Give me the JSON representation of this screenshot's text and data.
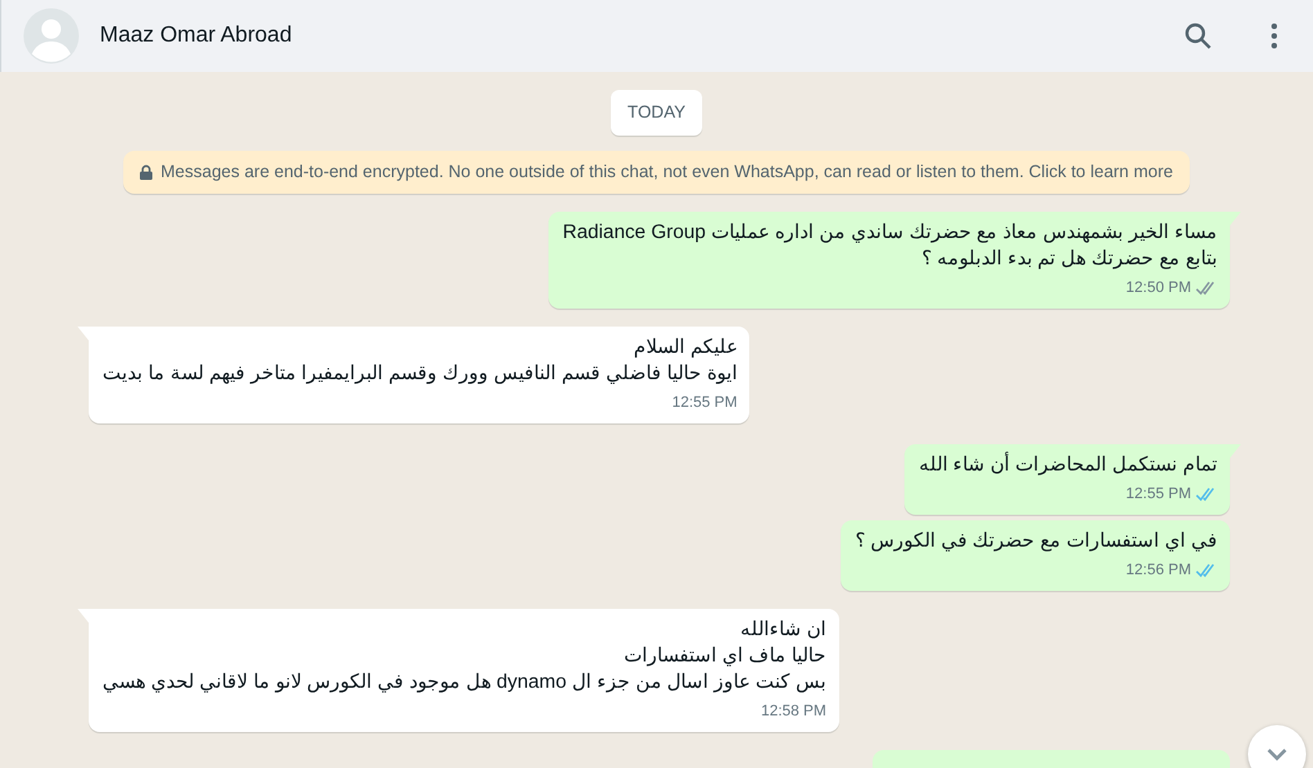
{
  "header": {
    "contact_name": "Maaz Omar Abroad"
  },
  "date_divider": "TODAY",
  "encryption_notice": "Messages are end-to-end encrypted. No one outside of this chat, not even WhatsApp, can read or listen to them. Click to learn more",
  "messages": [
    {
      "kind": "out",
      "lines": [
        "مساء الخير بشمهندس معاذ مع حضرتك ساندي من اداره عمليات Radiance Group",
        "بتابع مع حضرتك هل تم بدء الدبلومه ؟"
      ],
      "time": "12:50 PM",
      "tail": true,
      "read": false
    },
    {
      "kind": "in",
      "lines": [
        "عليكم السلام",
        "ايوة حاليا فاضلي قسم النافيس وورك وقسم البرايمفيرا متاخر فيهم لسة ما بديت"
      ],
      "time": "12:55 PM",
      "tail": true
    },
    {
      "kind": "out",
      "lines": [
        "تمام نستكمل المحاضرات أن شاء الله"
      ],
      "time": "12:55 PM",
      "tail": true,
      "read": true
    },
    {
      "kind": "out",
      "lines": [
        "في اي استفسارات مع حضرتك في الكورس ؟"
      ],
      "time": "12:56 PM",
      "tail": false,
      "read": true
    },
    {
      "kind": "in",
      "lines": [
        "ان شاءالله",
        "حاليا ماف اي استفسارات",
        "بس كنت عاوز اسال من جزء ال dynamo هل موجود في الكورس لانو ما لاقاني لحدي هسي"
      ],
      "time": "12:58 PM",
      "tail": true
    }
  ]
}
